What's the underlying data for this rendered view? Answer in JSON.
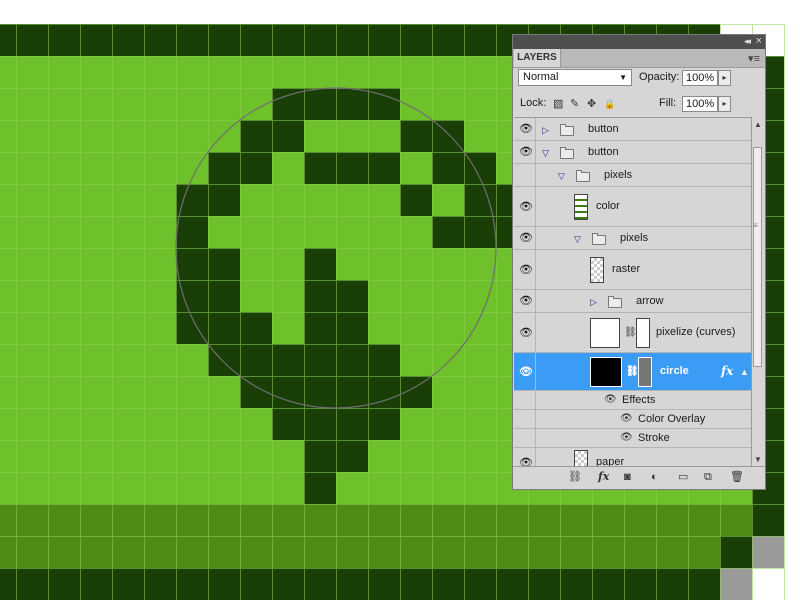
{
  "colors": {
    "canvas_light": "#6ec12a",
    "canvas_mid": "#4f8c16",
    "canvas_dark": "#1a3f06",
    "grid": "#8fd252",
    "selection_circle": "#6f6f6f",
    "panel_bg": "#d6d6d6",
    "selected_row": "#3b9cf5",
    "gray_pixel": "#9a9a9a"
  },
  "panel": {
    "tab_label": "LAYERS",
    "collapse_icon": "◂◂",
    "close_icon": "×",
    "menu_icon": "▾≡",
    "blend_mode": "Normal",
    "opacity_label": "Opacity:",
    "opacity_value": "100%",
    "lock_label": "Lock:",
    "fill_label": "Fill:",
    "fill_value": "100%",
    "step_arrow": "▸",
    "dropdown_arrow": "▼",
    "lock_icons": [
      "▧",
      "✎",
      "✥",
      "🔒"
    ]
  },
  "layers": [
    {
      "name": "button",
      "type": "group",
      "level": 0,
      "expanded": false,
      "visible": true
    },
    {
      "name": "button",
      "type": "group",
      "level": 0,
      "expanded": true,
      "visible": true
    },
    {
      "name": "pixels",
      "type": "group",
      "level": 1,
      "expanded": true,
      "visible": false
    },
    {
      "name": "color",
      "type": "layer",
      "level": 2,
      "visible": true
    },
    {
      "name": "pixels",
      "type": "group",
      "level": 2,
      "expanded": true,
      "visible": true
    },
    {
      "name": "raster",
      "type": "layer",
      "level": 3,
      "visible": true
    },
    {
      "name": "arrow",
      "type": "group",
      "level": 3,
      "expanded": false,
      "visible": true
    },
    {
      "name": "pixelize (curves)",
      "type": "adjustment",
      "level": 3,
      "visible": true
    },
    {
      "name": "circle",
      "type": "shape",
      "level": 3,
      "visible": true,
      "selected": true,
      "fx": "fx"
    },
    {
      "name": "Effects",
      "type": "effects",
      "level": 4,
      "visible": false
    },
    {
      "name": "Color Overlay",
      "type": "effect",
      "level": 5,
      "visible": false
    },
    {
      "name": "Stroke",
      "type": "effect",
      "level": 5,
      "visible": false
    },
    {
      "name": "paper",
      "type": "layer",
      "level": 2,
      "visible": true
    }
  ],
  "bottom_bar_icons": [
    "link-icon",
    "fx-icon",
    "mask-icon",
    "adjustment-icon",
    "folder-icon",
    "new-layer-icon",
    "trash-icon"
  ],
  "bottom_bar_glyphs": [
    "⛓",
    "fx",
    "◙",
    "◐",
    "▭",
    "⧉",
    "🗑"
  ],
  "glyphs": {
    "eye": "👁",
    "collapsed": "▷",
    "expanded": "▽",
    "chain": "🔗",
    "scroll_up": "▲",
    "scroll_down": "▼",
    "grip": "≡"
  }
}
